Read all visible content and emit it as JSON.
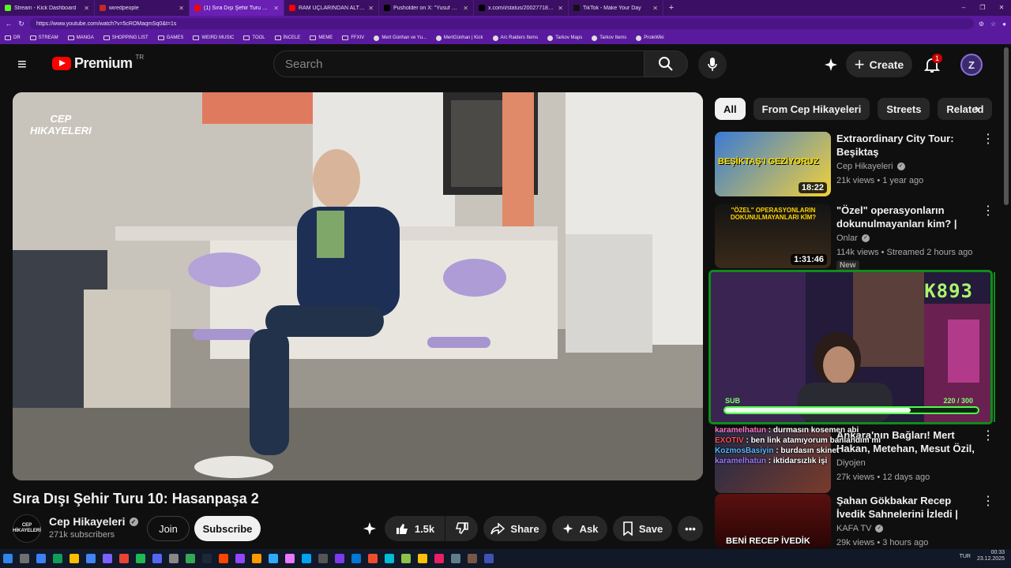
{
  "browser": {
    "tabs": [
      {
        "label": "Stream - Kick Dashboard",
        "color": "#53fc18"
      },
      {
        "label": "wiredpeople",
        "color": "#c62828"
      },
      {
        "label": "(1) Sıra Dışı Şehir Turu 10: Ha...",
        "color": "#ff0000",
        "active": true
      },
      {
        "label": "RAM UÇLARINDAN ALTIN ÇIKARMA",
        "color": "#ff0000"
      },
      {
        "label": "Pusholder on X: \"Yusuf Güney: \"B...",
        "color": "#000000"
      },
      {
        "label": "x.com/i/status/2002771862544323",
        "color": "#000000"
      },
      {
        "label": "TikTok - Make Your Day",
        "color": "#111111"
      }
    ],
    "new_tab": "+",
    "window_controls": [
      "–",
      "❐",
      "✕"
    ],
    "url": "https://www.youtube.com/watch?v=5cROMaqmSq0&t=1s"
  },
  "bookmarks": [
    {
      "label": "DR",
      "type": "folder"
    },
    {
      "label": "STREAM",
      "type": "folder"
    },
    {
      "label": "MANGA",
      "type": "folder"
    },
    {
      "label": "SHOPPING LIST",
      "type": "folder"
    },
    {
      "label": "GAMES",
      "type": "folder"
    },
    {
      "label": "WEIRD MUSIC",
      "type": "folder"
    },
    {
      "label": "TOOL",
      "type": "folder"
    },
    {
      "label": "İNCELE",
      "type": "folder"
    },
    {
      "label": "MEME",
      "type": "folder"
    },
    {
      "label": "FFXIV",
      "type": "folder"
    },
    {
      "label": "Mert Günhan ve Yu...",
      "type": "link"
    },
    {
      "label": "MertGünhan | Kick",
      "type": "link"
    },
    {
      "label": "Arc Raiders Items",
      "type": "link"
    },
    {
      "label": "Tarkov Maps",
      "type": "link"
    },
    {
      "label": "Tarkov Items",
      "type": "link"
    },
    {
      "label": "ProleWiki",
      "type": "link"
    }
  ],
  "header": {
    "logo_text": "Premium",
    "logo_region": "TR",
    "search_placeholder": "Search",
    "create_label": "Create",
    "notif_count": "1",
    "avatar_letter": "Z"
  },
  "video": {
    "title": "Sıra Dışı Şehir Turu 10: Hasanpaşa 2",
    "watermark": "CEP\nHIKAYELERI",
    "channel": "Cep Hikayeleri",
    "channel_avatar_text": "CEP HİKAYELERİ",
    "subscribers": "271k subscribers",
    "join_label": "Join",
    "subscribe_label": "Subscribe",
    "likes": "1.5k",
    "share_label": "Share",
    "ask_label": "Ask",
    "save_label": "Save"
  },
  "chips": [
    "All",
    "From Cep Hikayeleri",
    "Streets",
    "Related"
  ],
  "recommendations": [
    {
      "title": "Extraordinary City Tour: Beşiktaş",
      "channel": "Cep Hikayeleri",
      "verified": true,
      "meta": "21k views • 1 year ago",
      "duration": "18:22",
      "thumb_text": "BEŞİKTAŞ'I GEZİYORUZ"
    },
    {
      "title": "\"Özel\" operasyonların dokunulmayanları kim? | Canlı ...",
      "channel": "Onlar",
      "verified": true,
      "meta": "114k views • Streamed 2 hours ago",
      "duration": "1:31:46",
      "badge": "New",
      "thumb_text": "\"ÖZEL\" OPERASYONLARIN DOKUNULMAYANLARI KİM?"
    },
    {
      "title": "Ankara'nın Bağları! Mert Hakan, Metehan, Mesut Özil, Mo Sala...",
      "channel": "Diyojen",
      "verified": false,
      "meta": "27k views • 12 days ago",
      "duration": ""
    },
    {
      "title": "Şahan Gökbakar Recep İvedik Sahnelerini İzledi | Fenomen ...",
      "channel": "KAFA TV",
      "verified": true,
      "meta": "29k views • 3 hours ago",
      "duration": "",
      "thumb_text": "BENİ RECEP İVEDİK"
    }
  ],
  "stream_overlay": {
    "counter": "K893",
    "sub_label": "SUB",
    "sub_value": "220 / 300",
    "sub_progress": 0.733,
    "chat": [
      {
        "name": "karamelhatun",
        "text": ": durmasın kosemen abi"
      },
      {
        "name": "EXOTIV",
        "text": ": ben link atamıyorum banlandım mı"
      },
      {
        "name": "KozmosBasiyin",
        "text": ": burdasın skinet"
      },
      {
        "name": "karamelhatun",
        "text": ": iktidarsızlık işi"
      }
    ]
  },
  "taskbar": {
    "lang": "TUR",
    "time": "00:33",
    "date": "23.12.2025"
  }
}
